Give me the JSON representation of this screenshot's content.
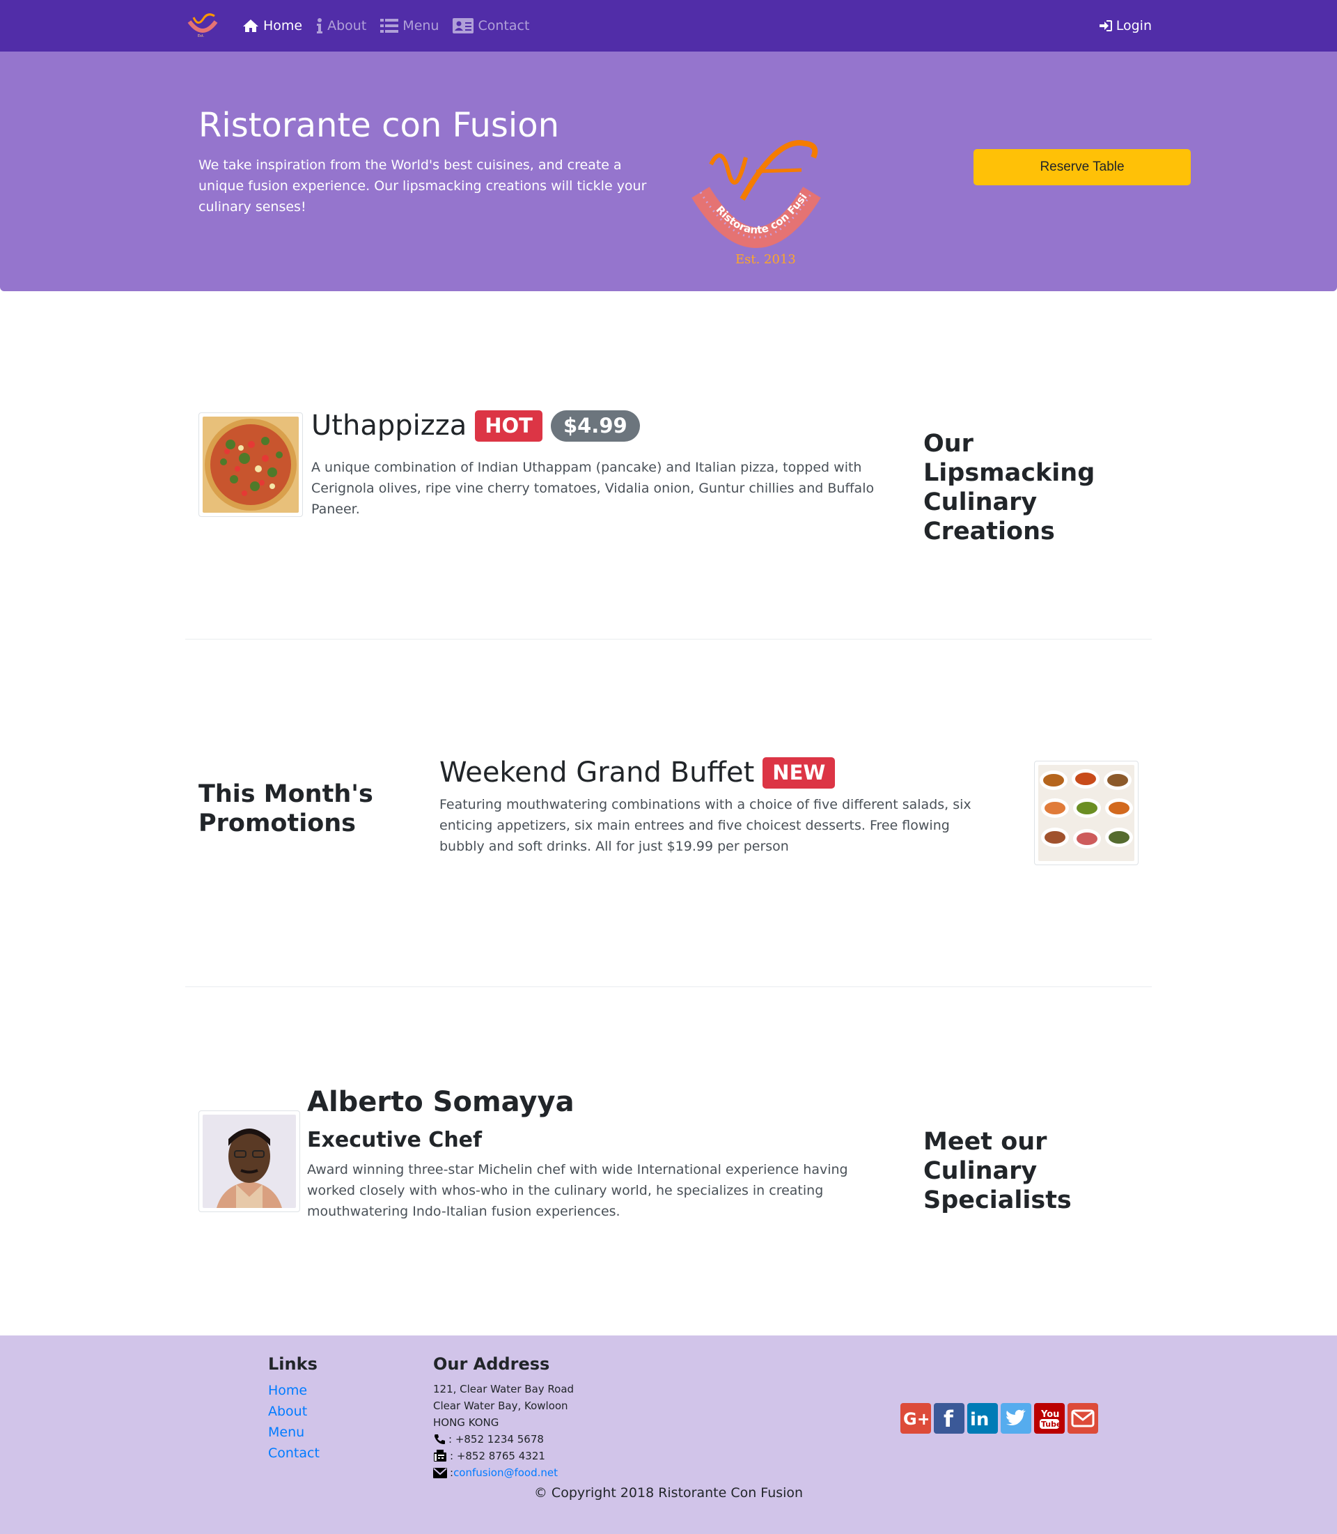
{
  "navbar": {
    "items": [
      {
        "label": "Home",
        "icon": "home-icon",
        "active": true
      },
      {
        "label": "About",
        "icon": "info-icon",
        "active": false
      },
      {
        "label": "Menu",
        "icon": "list-icon",
        "active": false
      },
      {
        "label": "Contact",
        "icon": "address-card-icon",
        "active": false
      }
    ],
    "login_label": "Login"
  },
  "jumbotron": {
    "title": "Ristorante con Fusion",
    "text": "We take inspiration from the World's best cuisines, and create a unique fusion experience. Our lipsmacking creations will tickle your culinary senses!",
    "reserve_label": "Reserve Table",
    "logo_text": "Ristorante con Fusion",
    "logo_est": "Est. 2013"
  },
  "dish": {
    "name": "Uthappizza",
    "badge": "HOT",
    "price": "$4.99",
    "description": "A unique combination of Indian Uthappam (pancake) and Italian pizza, topped with Cerignola olives, ripe vine cherry tomatoes, Vidalia onion, Guntur chillies and Buffalo Paneer.",
    "side_title": "Our Lipsmacking Culinary Creations"
  },
  "promotion": {
    "side_title": "This Month's Promotions",
    "name": "Weekend Grand Buffet",
    "badge": "NEW",
    "description": "Featuring mouthwatering combinations with a choice of five different salads, six enticing appetizers, six main entrees and five choicest desserts. Free flowing bubbly and soft drinks. All for just $19.99 per person"
  },
  "leader": {
    "name": "Alberto Somayya",
    "designation": "Executive Chef",
    "description": "Award winning three-star Michelin chef with wide International experience having worked closely with whos-who in the culinary world, he specializes in creating mouthwatering Indo-Italian fusion experiences.",
    "side_title": "Meet our Culinary Specialists"
  },
  "footer": {
    "links_title": "Links",
    "links": [
      "Home",
      "About",
      "Menu",
      "Contact"
    ],
    "address_title": "Our Address",
    "address_lines": [
      "121, Clear Water Bay Road",
      "Clear Water Bay, Kowloon",
      "HONG KONG"
    ],
    "phone": ": +852 1234 5678",
    "fax": ": +852 8765 4321",
    "email_prefix": ": ",
    "email": "confusion@food.net",
    "social": [
      {
        "icon": "google-plus-icon",
        "color": "#dd4b39"
      },
      {
        "icon": "facebook-icon",
        "color": "#3b5998"
      },
      {
        "icon": "linkedin-icon",
        "color": "#007bb6"
      },
      {
        "icon": "twitter-icon",
        "color": "#55acee"
      },
      {
        "icon": "youtube-icon",
        "color": "#bb0000"
      },
      {
        "icon": "mail-icon",
        "color": "#dd4b39"
      }
    ],
    "copyright": "© Copyright 2018 Ristorante Con Fusion"
  },
  "colors": {
    "navbar": "#512da8",
    "jumbotron": "#9575cd",
    "footer": "#d1c4e9",
    "reserve_button": "#ffc107",
    "badge_danger": "#dc3545",
    "badge_price": "#6c757d",
    "link": "#007bff"
  }
}
